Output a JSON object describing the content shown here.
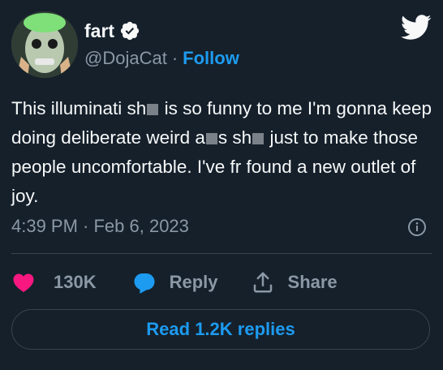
{
  "author": {
    "display_name": "fart",
    "handle": "@DojaCat",
    "separator": "·",
    "follow_label": "Follow",
    "verified": true
  },
  "tweet": {
    "text_parts": [
      "This illuminati sh",
      " is so funny to me I'm gonna keep doing deliberate weird a",
      "s sh",
      " just to make those people uncomfortable. I've fr found a new outlet of joy."
    ],
    "timestamp": "4:39 PM · Feb 6, 2023"
  },
  "actions": {
    "like_count": "130K",
    "reply_label": "Reply",
    "share_label": "Share"
  },
  "replies_button": "Read 1.2K replies",
  "colors": {
    "background": "#15202b",
    "accent": "#1d9bf0",
    "like": "#f91880",
    "muted": "#8b98a5"
  },
  "icons": [
    "verified-badge-icon",
    "twitter-bird-icon",
    "info-icon",
    "heart-icon",
    "reply-bubble-icon",
    "share-icon"
  ]
}
